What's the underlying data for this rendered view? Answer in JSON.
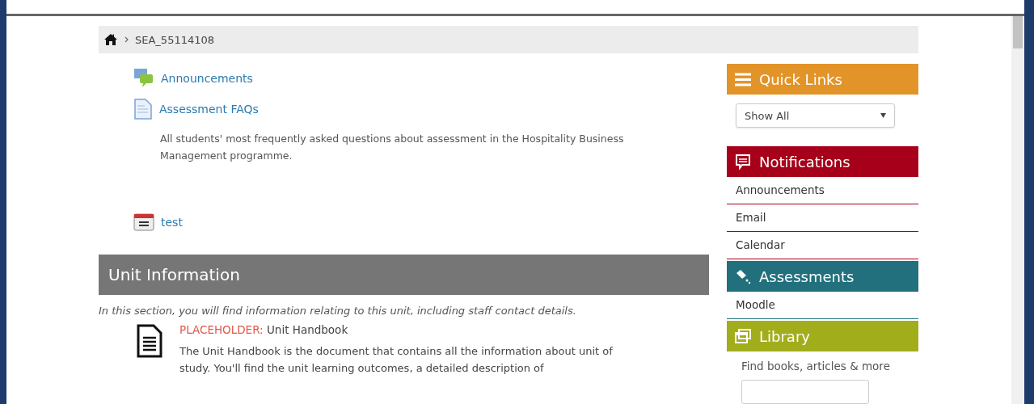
{
  "breadcrumb": {
    "items": [
      "SEA_55114108"
    ]
  },
  "activities": [
    {
      "kind": "forum",
      "title": "Announcements"
    },
    {
      "kind": "page",
      "title": "Assessment FAQs",
      "description": "All students' most frequently asked questions about assessment in the Hospitality Business Management programme."
    },
    {
      "kind": "calendar",
      "title": "test"
    }
  ],
  "section": {
    "title": "Unit Information",
    "summary": "In this section, you will find information relating to this unit, including staff contact details.",
    "resources": [
      {
        "tag": "PLACEHOLDER:",
        "title": "Unit Handbook",
        "description": "The Unit Handbook is the document that contains all the information about unit of study. You'll find the unit learning outcomes, a detailed description of"
      }
    ]
  },
  "sidebar": [
    {
      "kind": "select",
      "title": "Quick Links",
      "color": "#e39428",
      "value": "Show All"
    },
    {
      "kind": "links",
      "title": "Notifications",
      "color": "#a6001a",
      "links": [
        "Announcements",
        "Email",
        "Calendar"
      ]
    },
    {
      "kind": "links",
      "title": "Assessments",
      "color": "#22707d",
      "links": [
        "Moodle"
      ]
    },
    {
      "kind": "search",
      "title": "Library",
      "color": "#a2ad1c",
      "text": "Find books, articles & more"
    }
  ]
}
